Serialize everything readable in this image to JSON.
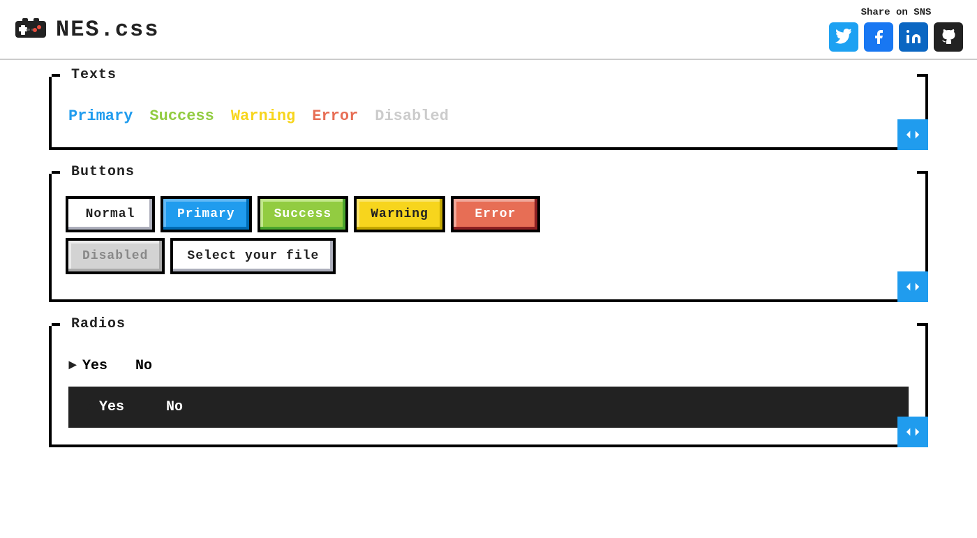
{
  "header": {
    "logo_text": "NES.css",
    "sns_label": "Share on SNS",
    "sns_icons": [
      {
        "name": "twitter",
        "label": "Twitter"
      },
      {
        "name": "facebook",
        "label": "Facebook"
      },
      {
        "name": "linkedin",
        "label": "LinkedIn"
      },
      {
        "name": "github",
        "label": "GitHub"
      }
    ]
  },
  "texts_panel": {
    "title": "Texts",
    "items": [
      {
        "label": "Primary",
        "class": "text-primary"
      },
      {
        "label": "Success",
        "class": "text-success"
      },
      {
        "label": "Warning",
        "class": "text-warning"
      },
      {
        "label": "Error",
        "class": "text-error"
      },
      {
        "label": "Disabled",
        "class": "text-disabled"
      }
    ],
    "code_btn_label": "<>"
  },
  "buttons_panel": {
    "title": "Buttons",
    "buttons_row1": [
      {
        "label": "Normal",
        "type": "normal"
      },
      {
        "label": "Primary",
        "type": "primary"
      },
      {
        "label": "Success",
        "type": "success"
      },
      {
        "label": "Warning",
        "type": "warning"
      },
      {
        "label": "Error",
        "type": "error"
      }
    ],
    "buttons_row2": [
      {
        "label": "Disabled",
        "type": "disabled"
      },
      {
        "label": "Select your file",
        "type": "file"
      }
    ],
    "code_btn_label": "<>"
  },
  "radios_panel": {
    "title": "Radios",
    "light_radios": [
      {
        "label": "Yes",
        "selected": true
      },
      {
        "label": "No",
        "selected": false
      }
    ],
    "dark_radios": [
      {
        "label": "Yes",
        "selected": true
      },
      {
        "label": "No",
        "selected": false
      }
    ],
    "code_btn_label": "<>"
  }
}
